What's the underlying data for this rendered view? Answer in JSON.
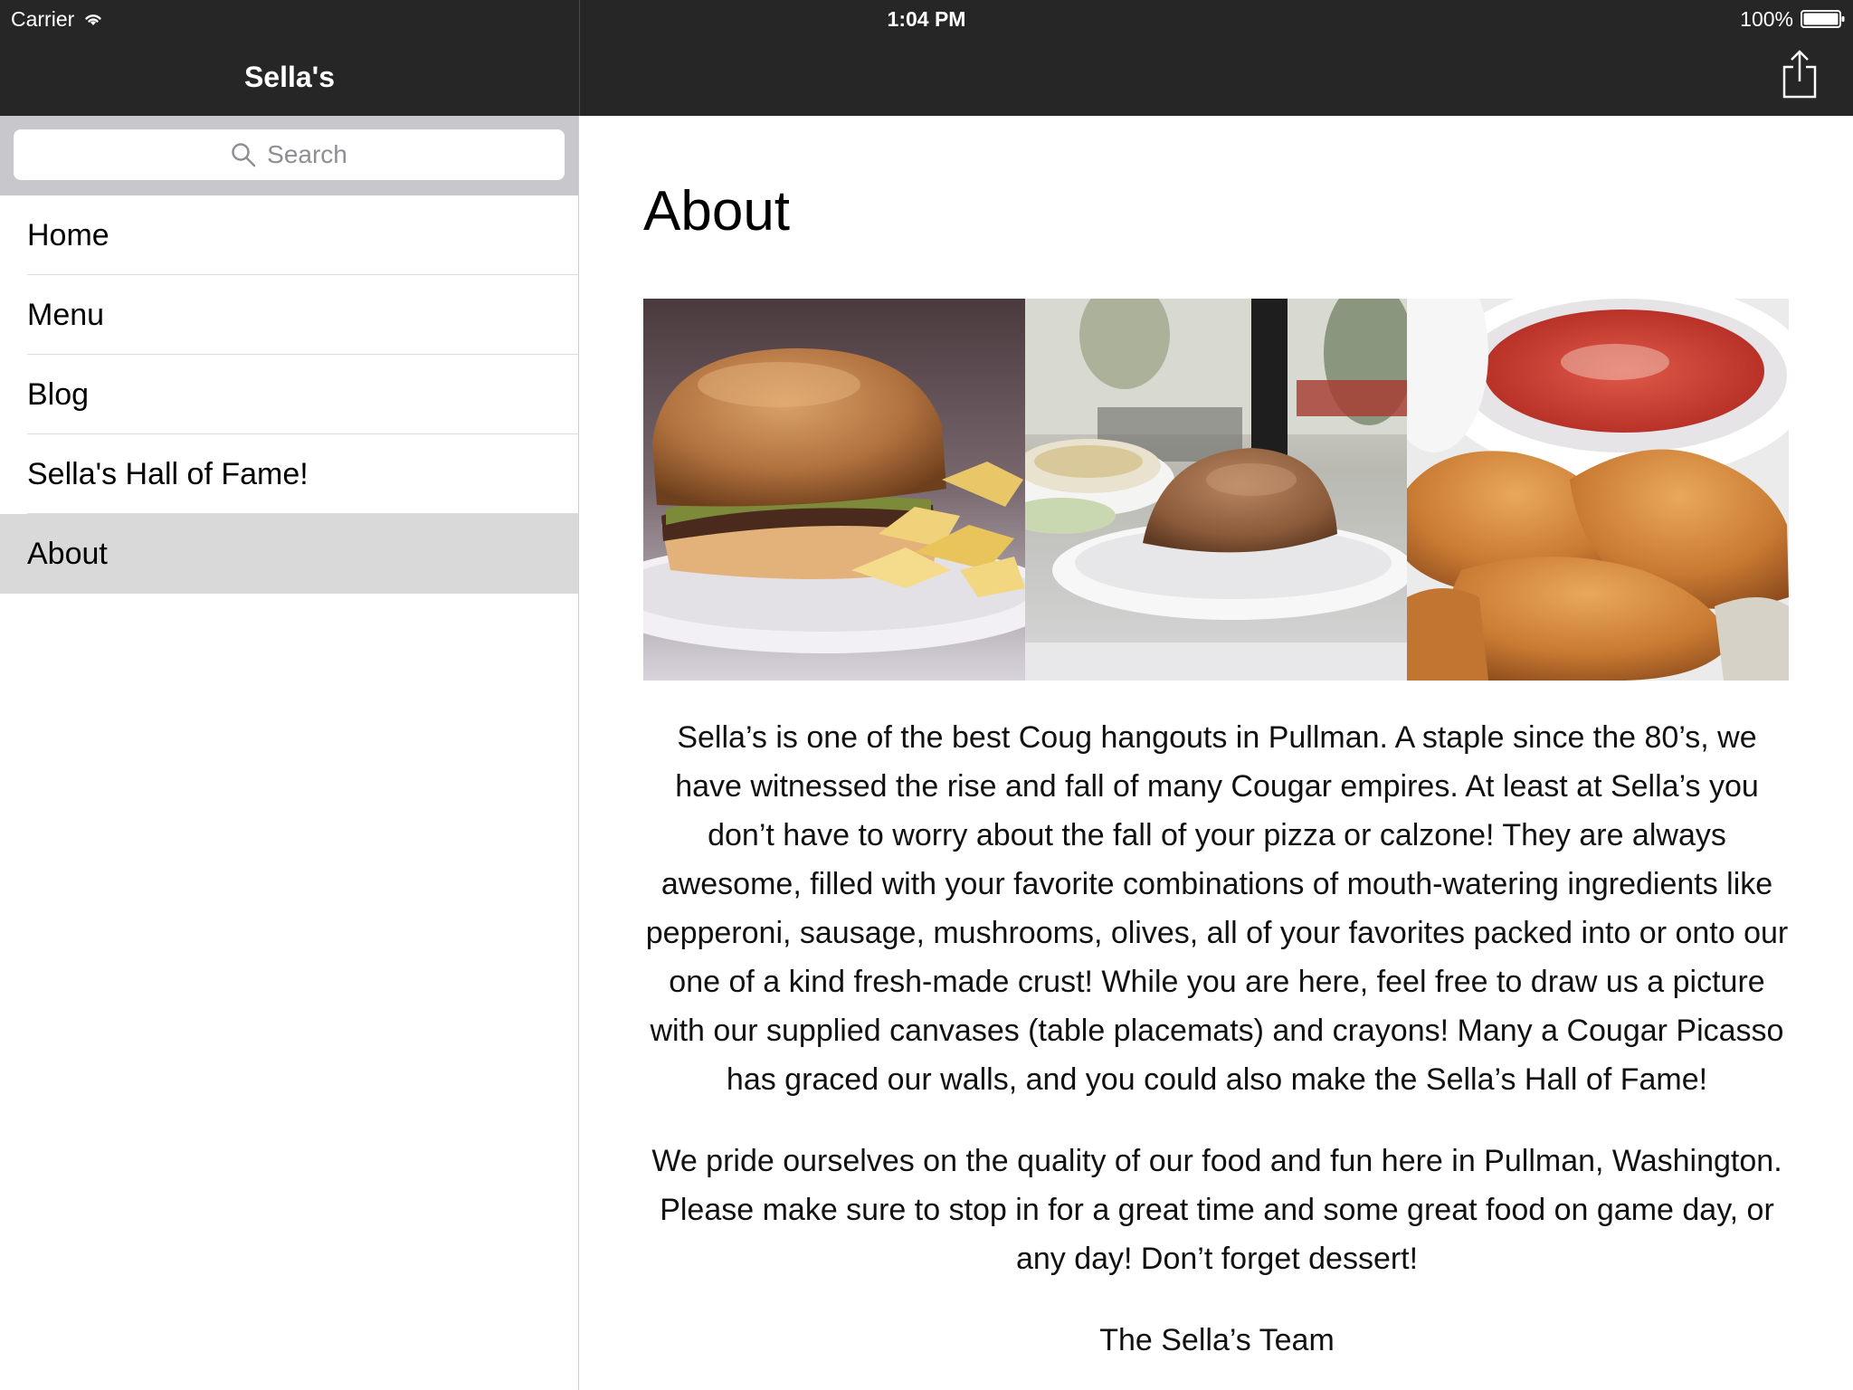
{
  "status_bar": {
    "carrier": "Carrier",
    "time": "1:04 PM",
    "battery": "100%"
  },
  "sidebar": {
    "title": "Sella's",
    "search_placeholder": "Search",
    "items": [
      {
        "label": "Home",
        "selected": false
      },
      {
        "label": "Menu",
        "selected": false
      },
      {
        "label": "Blog",
        "selected": false
      },
      {
        "label": "Sella's Hall of Fame!",
        "selected": false
      },
      {
        "label": "About",
        "selected": true
      }
    ]
  },
  "content": {
    "title": "About",
    "paragraphs": [
      "Sella’s is one of the best Coug hangouts in Pullman. A staple since the 80’s, we have witnessed the rise and fall of many Cougar empires. At least at Sella’s you don’t have to worry about the fall of your pizza or calzone! They are always awesome, filled with your favorite combinations of mouth-watering ingredients like pepperoni, sausage, mushrooms, olives, all of your favorites packed into or onto our one of a kind fresh-made crust! While you are here, feel free to draw us a picture with our supplied canvases (table placemats) and crayons! Many a Cougar Picasso has graced our walls, and you could also make the Sella’s Hall of Fame!",
      "We pride ourselves on the quality of our food and fun here in Pullman, Washington. Please make sure to stop in for a great time and some great food on game day, or any day! Don’t forget dessert!",
      "The Sella’s Team"
    ]
  },
  "colors": {
    "bar_background": "#262626",
    "selected_row": "#d9d9d9",
    "search_tray": "#c8c8cc"
  }
}
